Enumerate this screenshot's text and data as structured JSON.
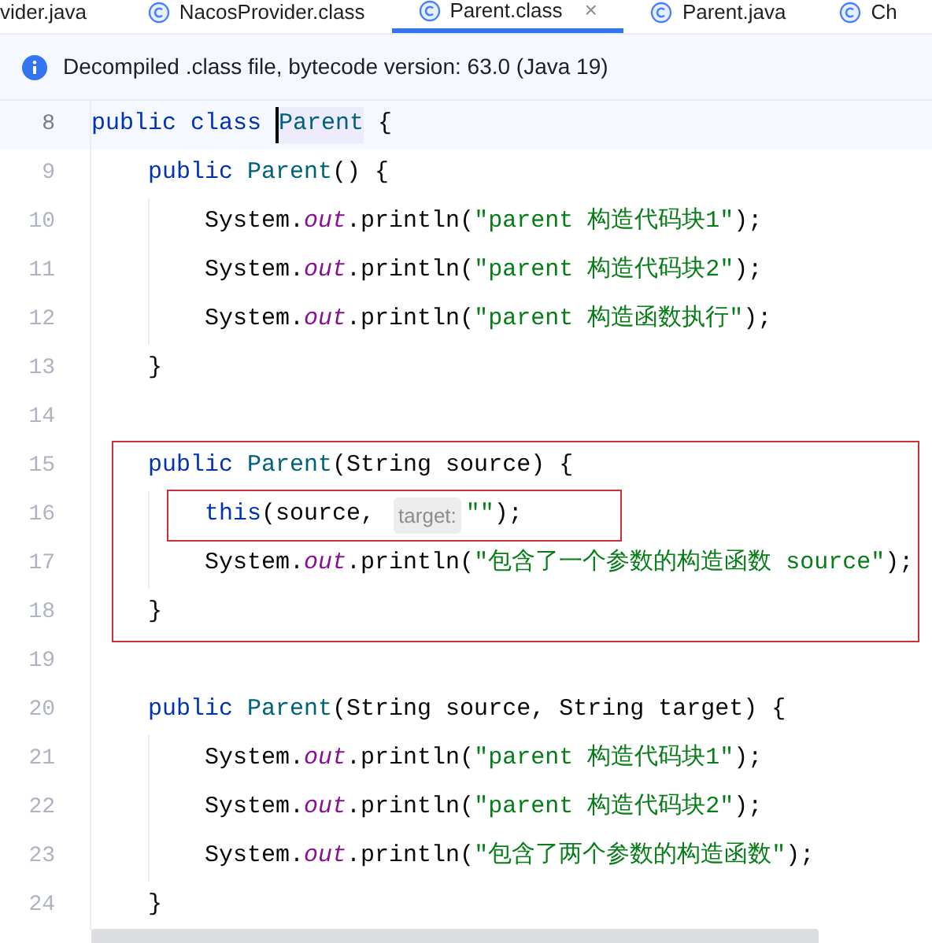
{
  "tabs": [
    {
      "label": "vider.java",
      "icon": false,
      "selected": false,
      "closable": false
    },
    {
      "label": "NacosProvider.class",
      "icon": true,
      "selected": false,
      "closable": false
    },
    {
      "label": "Parent.class",
      "icon": true,
      "selected": true,
      "closable": true,
      "close_glyph": "×"
    },
    {
      "label": "Parent.java",
      "icon": true,
      "selected": false,
      "closable": false
    },
    {
      "label": "Ch",
      "icon": true,
      "selected": false,
      "closable": false
    }
  ],
  "info_bar": {
    "text": "Decompiled .class file, bytecode version: 63.0 (Java 19)"
  },
  "editor": {
    "blocks": [
      {
        "outlined": false,
        "lines": [
          {
            "number": "8",
            "current": true,
            "outlined": false,
            "tokens": [
              {
                "kind": "keyword",
                "text": "public class "
              },
              {
                "kind": "type",
                "text": "Parent",
                "caret": true
              },
              {
                "kind": "plain",
                "text": " {"
              }
            ]
          },
          {
            "number": "9",
            "current": false,
            "outlined": false,
            "tokens": [
              {
                "kind": "keyword",
                "text": "    public "
              },
              {
                "kind": "type",
                "text": "Parent"
              },
              {
                "kind": "plain",
                "text": "() {"
              }
            ]
          },
          {
            "number": "10",
            "current": false,
            "outlined": false,
            "tokens": [
              {
                "kind": "plain",
                "text": "        System."
              },
              {
                "kind": "field",
                "text": "out"
              },
              {
                "kind": "plain",
                "text": ".println("
              },
              {
                "kind": "string",
                "text": "\"parent 构造代码块1\""
              },
              {
                "kind": "plain",
                "text": ");"
              }
            ]
          },
          {
            "number": "11",
            "current": false,
            "outlined": false,
            "tokens": [
              {
                "kind": "plain",
                "text": "        System."
              },
              {
                "kind": "field",
                "text": "out"
              },
              {
                "kind": "plain",
                "text": ".println("
              },
              {
                "kind": "string",
                "text": "\"parent 构造代码块2\""
              },
              {
                "kind": "plain",
                "text": ");"
              }
            ]
          },
          {
            "number": "12",
            "current": false,
            "outlined": false,
            "tokens": [
              {
                "kind": "plain",
                "text": "        System."
              },
              {
                "kind": "field",
                "text": "out"
              },
              {
                "kind": "plain",
                "text": ".println("
              },
              {
                "kind": "string",
                "text": "\"parent 构造函数执行\""
              },
              {
                "kind": "plain",
                "text": ");"
              }
            ]
          },
          {
            "number": "13",
            "current": false,
            "outlined": false,
            "tokens": [
              {
                "kind": "plain",
                "text": "    }"
              }
            ]
          },
          {
            "number": "14",
            "current": false,
            "outlined": false
          }
        ]
      },
      {
        "outlined": true,
        "lines": [
          {
            "number": "15",
            "current": false,
            "outlined": false,
            "tokens": [
              {
                "kind": "keyword",
                "text": "    public "
              },
              {
                "kind": "type",
                "text": "Parent"
              },
              {
                "kind": "plain",
                "text": "(String source) {"
              }
            ]
          },
          {
            "number": "16",
            "current": false,
            "outlined": true,
            "tokens": [
              {
                "kind": "keyword",
                "text": "        this"
              },
              {
                "kind": "plain",
                "text": "(source, "
              },
              {
                "kind": "hint",
                "text": "target:"
              },
              {
                "kind": "string",
                "text": "\"\""
              },
              {
                "kind": "plain",
                "text": ");"
              }
            ]
          },
          {
            "number": "17",
            "current": false,
            "outlined": false,
            "tokens": [
              {
                "kind": "plain",
                "text": "        System."
              },
              {
                "kind": "field",
                "text": "out"
              },
              {
                "kind": "plain",
                "text": ".println("
              },
              {
                "kind": "string",
                "text": "\"包含了一个参数的构造函数 source\""
              },
              {
                "kind": "plain",
                "text": ");"
              }
            ]
          },
          {
            "number": "18",
            "current": false,
            "outlined": false,
            "tokens": [
              {
                "kind": "plain",
                "text": "    }"
              }
            ]
          }
        ]
      },
      {
        "outlined": false,
        "lines": [
          {
            "number": "19",
            "current": false,
            "outlined": false
          },
          {
            "number": "20",
            "current": false,
            "outlined": false,
            "tokens": [
              {
                "kind": "keyword",
                "text": "    public "
              },
              {
                "kind": "type",
                "text": "Parent"
              },
              {
                "kind": "plain",
                "text": "(String source, String target) {"
              }
            ]
          },
          {
            "number": "21",
            "current": false,
            "outlined": false,
            "tokens": [
              {
                "kind": "plain",
                "text": "        System."
              },
              {
                "kind": "field",
                "text": "out"
              },
              {
                "kind": "plain",
                "text": ".println("
              },
              {
                "kind": "string",
                "text": "\"parent 构造代码块1\""
              },
              {
                "kind": "plain",
                "text": ");"
              }
            ]
          },
          {
            "number": "22",
            "current": false,
            "outlined": false,
            "tokens": [
              {
                "kind": "plain",
                "text": "        System."
              },
              {
                "kind": "field",
                "text": "out"
              },
              {
                "kind": "plain",
                "text": ".println("
              },
              {
                "kind": "string",
                "text": "\"parent 构造代码块2\""
              },
              {
                "kind": "plain",
                "text": ");"
              }
            ]
          },
          {
            "number": "23",
            "current": false,
            "outlined": false,
            "tokens": [
              {
                "kind": "plain",
                "text": "        System."
              },
              {
                "kind": "field",
                "text": "out"
              },
              {
                "kind": "plain",
                "text": ".println("
              },
              {
                "kind": "string",
                "text": "\"包含了两个参数的构造函数\""
              },
              {
                "kind": "plain",
                "text": ");"
              }
            ]
          },
          {
            "number": "24",
            "current": false,
            "outlined": false,
            "tokens": [
              {
                "kind": "plain",
                "text": "    }"
              }
            ]
          }
        ]
      }
    ]
  }
}
